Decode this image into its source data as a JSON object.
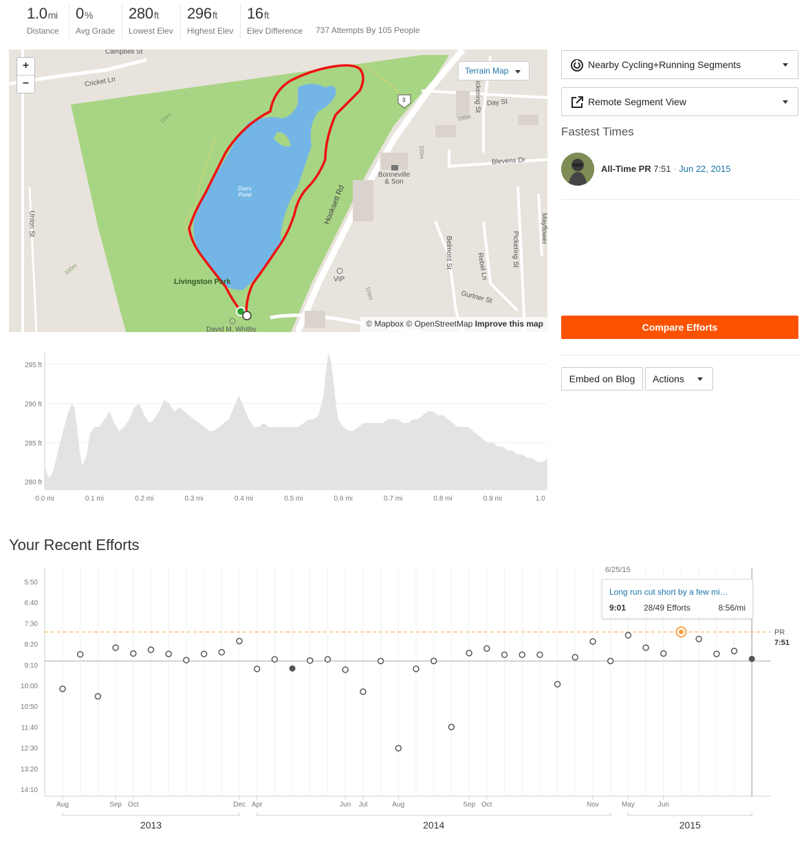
{
  "stats": [
    {
      "value": "1.0",
      "unit": "mi",
      "label": "Distance"
    },
    {
      "value": "0",
      "unit": "%",
      "label": "Avg Grade"
    },
    {
      "value": "280",
      "unit": "ft",
      "label": "Lowest Elev"
    },
    {
      "value": "296",
      "unit": "ft",
      "label": "Highest Elev"
    },
    {
      "value": "16",
      "unit": "ft",
      "label": "Elev Difference"
    }
  ],
  "attempts": "737 Attempts By 105 People",
  "map": {
    "zoom_in": "+",
    "zoom_out": "−",
    "terrain_label": "Terrain Map",
    "attribution_mapbox": "© Mapbox",
    "attribution_osm": "© OpenStreetMap",
    "attribution_improve": "Improve this map",
    "labels": {
      "campbell": "Campbell St",
      "cricket": "Cricket Ln",
      "union": "Union St",
      "park": "Livingston Park",
      "pond": "Dorrs Pond",
      "hooksett": "Hooksett Rd",
      "pickering": "Pickering St",
      "day": "Day St",
      "blevens": "Blevens Dr",
      "bonneville": "Bonneville & Son",
      "belmont": "Belmont St",
      "rebel": "Rebel Ln",
      "pickering2": "Pickering St",
      "mayflower": "Mayflower",
      "vip": "VIP",
      "gurtner": "Gurtner St",
      "whitby": "David M. Whitby",
      "route": "3",
      "contour": "100m"
    }
  },
  "segments_dropdown": "Nearby Cycling+Running Segments",
  "remote_view": "Remote Segment View",
  "fastest": {
    "title": "Fastest Times",
    "pr_label": "All-Time PR",
    "pr_time": "7:51",
    "sep": "·",
    "pr_date": "Jun 22, 2015"
  },
  "buttons": {
    "compare": "Compare Efforts",
    "embed": "Embed on Blog",
    "actions": "Actions"
  },
  "elevation_chart": {
    "type": "area",
    "ytick_labels": [
      "295 ft",
      "290 ft",
      "285 ft",
      "280 ft"
    ],
    "yticks": [
      295,
      290,
      285,
      280
    ],
    "ylim": [
      279,
      296.5
    ],
    "xtick_labels": [
      "0.0 mi",
      "0.1 mi",
      "0.2 mi",
      "0.3 mi",
      "0.4 mi",
      "0.5 mi",
      "0.6 mi",
      "0.7 mi",
      "0.8 mi",
      "0.9 mi",
      "1.0 r"
    ],
    "xticks": [
      0.0,
      0.1,
      0.2,
      0.3,
      0.4,
      0.5,
      0.6,
      0.7,
      0.8,
      0.9,
      1.0
    ],
    "xlim": [
      0,
      1.01
    ],
    "x": [
      0,
      0.005,
      0.01,
      0.018,
      0.025,
      0.035,
      0.045,
      0.055,
      0.06,
      0.065,
      0.07,
      0.075,
      0.085,
      0.09,
      0.1,
      0.11,
      0.12,
      0.13,
      0.14,
      0.15,
      0.16,
      0.17,
      0.18,
      0.19,
      0.2,
      0.21,
      0.22,
      0.23,
      0.24,
      0.25,
      0.26,
      0.27,
      0.28,
      0.29,
      0.3,
      0.31,
      0.32,
      0.33,
      0.34,
      0.35,
      0.36,
      0.37,
      0.38,
      0.39,
      0.4,
      0.41,
      0.42,
      0.43,
      0.44,
      0.45,
      0.46,
      0.47,
      0.48,
      0.49,
      0.5,
      0.51,
      0.52,
      0.53,
      0.54,
      0.55,
      0.56,
      0.565,
      0.57,
      0.575,
      0.58,
      0.585,
      0.59,
      0.6,
      0.61,
      0.62,
      0.63,
      0.64,
      0.65,
      0.66,
      0.67,
      0.68,
      0.69,
      0.7,
      0.71,
      0.72,
      0.73,
      0.74,
      0.75,
      0.76,
      0.77,
      0.78,
      0.79,
      0.8,
      0.81,
      0.82,
      0.83,
      0.84,
      0.85,
      0.86,
      0.87,
      0.88,
      0.89,
      0.9,
      0.91,
      0.92,
      0.93,
      0.94,
      0.95,
      0.96,
      0.97,
      0.98,
      0.99,
      1.0,
      1.01
    ],
    "y": [
      282,
      281,
      280.5,
      281.5,
      283.5,
      286,
      288.5,
      290,
      289.5,
      287,
      284,
      282,
      283.5,
      286,
      287,
      287,
      288,
      289,
      287.5,
      286.5,
      287,
      288,
      289.5,
      290,
      288.5,
      287.5,
      288,
      289,
      290.5,
      290,
      289,
      289.5,
      289,
      288.5,
      288,
      287.5,
      287,
      286.5,
      286.5,
      287,
      287.5,
      288,
      289.5,
      291,
      289.5,
      288,
      287,
      287,
      287.5,
      287,
      287,
      287,
      287,
      287,
      287,
      287,
      287.5,
      288,
      288,
      288.5,
      291,
      294,
      296.5,
      295.5,
      293,
      290,
      288,
      287,
      286.5,
      286.5,
      287,
      287.5,
      287.5,
      287.5,
      287.5,
      287.5,
      288,
      288,
      288,
      287.5,
      287.5,
      288,
      288,
      288.5,
      289,
      289,
      288.5,
      288.5,
      288,
      287.5,
      287,
      287,
      287,
      286.5,
      286,
      285.5,
      285,
      285,
      284.5,
      284.5,
      284,
      284,
      283.5,
      283.5,
      283,
      283,
      282.5,
      282.5,
      283,
      283.5,
      284
    ]
  },
  "recent": {
    "title": "Your Recent Efforts",
    "tooltip_date": "6/25/15",
    "tooltip_title": "Long run cut short by a few mi…",
    "tooltip_time": "9:01",
    "tooltip_efforts": "28/49 Efforts",
    "tooltip_pace": "8:56/mi",
    "pr_label": "PR",
    "pr_value": "7:51"
  },
  "chart_data": {
    "type": "scatter",
    "ytick_labels": [
      "5:50",
      "6:40",
      "7:30",
      "8:20",
      "9:10",
      "10:00",
      "10:50",
      "11:40",
      "12:30",
      "13:20",
      "14:10"
    ],
    "yticks": [
      350,
      400,
      450,
      500,
      550,
      600,
      650,
      700,
      750,
      800,
      850
    ],
    "ylim": [
      325,
      865
    ],
    "pr_seconds": 471,
    "median_seconds": 541,
    "xtick_labels": [
      "Aug",
      "Sep",
      "Oct",
      "Dec",
      "Apr",
      "Jun",
      "Jul",
      "Aug",
      "Sep",
      "Oct",
      "Nov",
      "May",
      "Jun"
    ],
    "xtick_index": [
      0,
      3,
      4,
      10,
      11,
      16,
      17,
      19,
      23,
      24,
      30,
      32,
      34
    ],
    "year_labels": [
      "2013",
      "2014",
      "2015"
    ],
    "year_ranges": [
      [
        0,
        10
      ],
      [
        11,
        31
      ],
      [
        32,
        39
      ]
    ],
    "n_slots": 40,
    "points": [
      {
        "i": 0,
        "t": 608,
        "style": "open"
      },
      {
        "i": 1,
        "t": 525,
        "style": "open"
      },
      {
        "i": 2,
        "t": 626,
        "style": "open"
      },
      {
        "i": 3,
        "t": 509,
        "style": "open"
      },
      {
        "i": 4,
        "t": 523,
        "style": "open"
      },
      {
        "i": 5,
        "t": 514,
        "style": "open"
      },
      {
        "i": 6,
        "t": 524,
        "style": "open"
      },
      {
        "i": 7,
        "t": 539,
        "style": "open"
      },
      {
        "i": 8,
        "t": 524,
        "style": "open"
      },
      {
        "i": 9,
        "t": 520,
        "style": "open"
      },
      {
        "i": 10,
        "t": 493,
        "style": "open"
      },
      {
        "i": 11,
        "t": 560,
        "style": "open"
      },
      {
        "i": 12,
        "t": 537,
        "style": "open"
      },
      {
        "i": 13,
        "t": 559,
        "style": "filled"
      },
      {
        "i": 14,
        "t": 540,
        "style": "open"
      },
      {
        "i": 15,
        "t": 537,
        "style": "open"
      },
      {
        "i": 16,
        "t": 562,
        "style": "open"
      },
      {
        "i": 17,
        "t": 615,
        "style": "open"
      },
      {
        "i": 18,
        "t": 541,
        "style": "open"
      },
      {
        "i": 19,
        "t": 751,
        "style": "open"
      },
      {
        "i": 20,
        "t": 560,
        "style": "open"
      },
      {
        "i": 21,
        "t": 541,
        "style": "open"
      },
      {
        "i": 22,
        "t": 700,
        "style": "open"
      },
      {
        "i": 23,
        "t": 522,
        "style": "open"
      },
      {
        "i": 24,
        "t": 511,
        "style": "open"
      },
      {
        "i": 25,
        "t": 526,
        "style": "open"
      },
      {
        "i": 26,
        "t": 526,
        "style": "open"
      },
      {
        "i": 27,
        "t": 526,
        "style": "open"
      },
      {
        "i": 28,
        "t": 597,
        "style": "open"
      },
      {
        "i": 29,
        "t": 532,
        "style": "open"
      },
      {
        "i": 30,
        "t": 494,
        "style": "open"
      },
      {
        "i": 31,
        "t": 541,
        "style": "open"
      },
      {
        "i": 32,
        "t": 479,
        "style": "open"
      },
      {
        "i": 33,
        "t": 509,
        "style": "open"
      },
      {
        "i": 34,
        "t": 523,
        "style": "open"
      },
      {
        "i": 35,
        "t": 471,
        "style": "pr"
      },
      {
        "i": 36,
        "t": 488,
        "style": "open"
      },
      {
        "i": 37,
        "t": 524,
        "style": "open"
      },
      {
        "i": 38,
        "t": 517,
        "style": "open"
      },
      {
        "i": 39,
        "t": 536,
        "style": "selected"
      }
    ]
  }
}
